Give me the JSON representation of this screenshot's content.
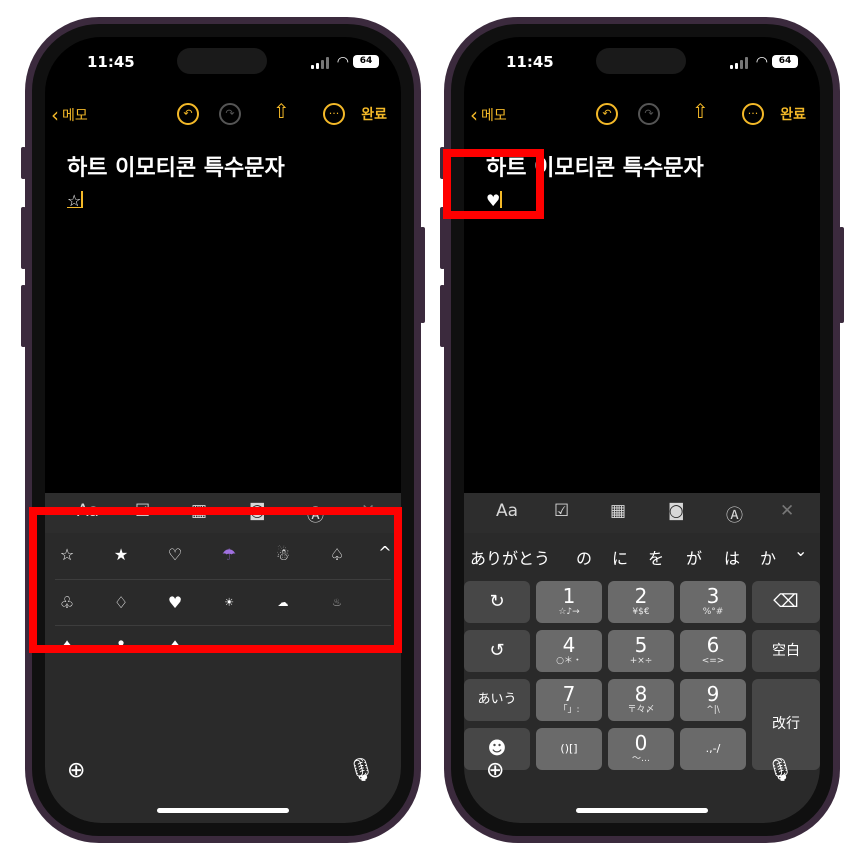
{
  "status": {
    "time": "11:45",
    "battery": "64"
  },
  "nav": {
    "back_label": "메모",
    "done_label": "완료"
  },
  "note": {
    "title": "하트 이모티콘 특수문자",
    "left_body": "☆",
    "right_body": "♥"
  },
  "toolbar": {
    "format_label": "Aa"
  },
  "symbols": {
    "row1": [
      "☆",
      "★",
      "♡",
      "☂",
      "☃",
      "♤"
    ],
    "row2": [
      "♧",
      "♢",
      "♥",
      "☀",
      "☁",
      "♨"
    ],
    "row3": [
      "♠",
      "♣",
      "♦"
    ]
  },
  "candidates": [
    "ありがとう",
    "の",
    "に",
    "を",
    "が",
    "は",
    "か"
  ],
  "keys": {
    "k1": {
      "main": "1",
      "sub": "☆♪→"
    },
    "k2": {
      "main": "2",
      "sub": "¥$€"
    },
    "k3": {
      "main": "3",
      "sub": "%°#"
    },
    "k4": {
      "main": "4",
      "sub": "○＊・"
    },
    "k5": {
      "main": "5",
      "sub": "+×÷"
    },
    "k6": {
      "main": "6",
      "sub": "<=>"
    },
    "k7": {
      "main": "7",
      "sub": "「」:"
    },
    "k8": {
      "main": "8",
      "sub": "〒々〆"
    },
    "k9": {
      "main": "9",
      "sub": "^|\\"
    },
    "k0": {
      "main": "0",
      "sub": "〜…"
    },
    "brackets": "()[]",
    "punct": ".,-/",
    "space": "空白",
    "kana": "あいう",
    "enter": "改行"
  },
  "colors": {
    "accent": "#f4b928",
    "highlight": "#ff0000",
    "frame": "#3b2a3d"
  }
}
